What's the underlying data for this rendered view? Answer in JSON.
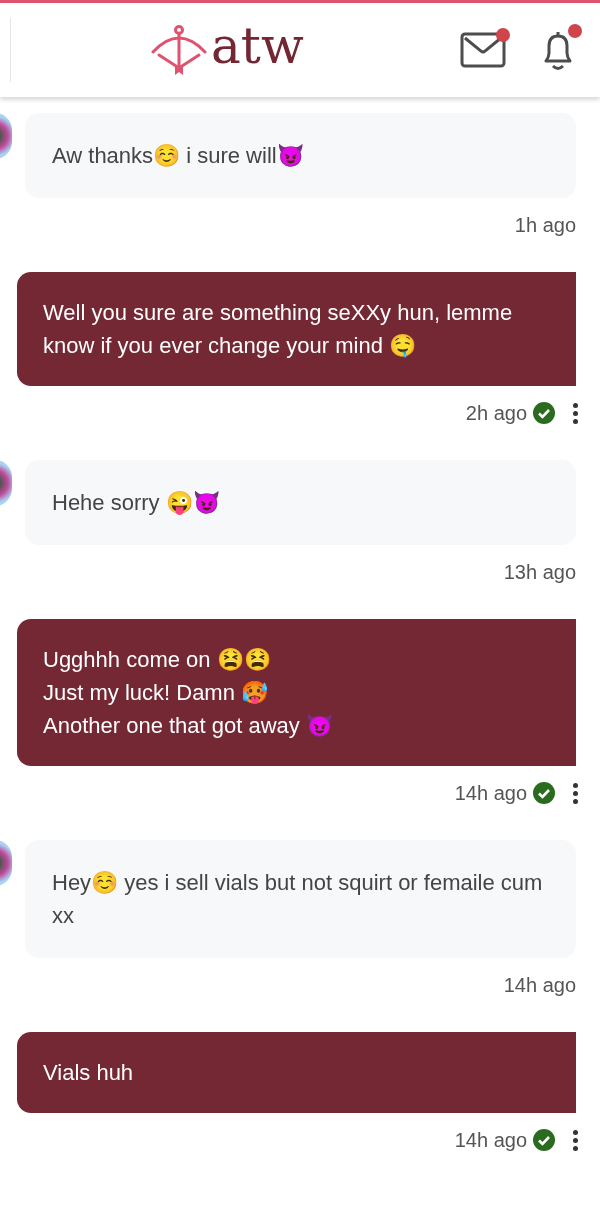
{
  "header": {
    "logo_text": "atw",
    "mail_unread": true,
    "bell_unread": true
  },
  "messages": [
    {
      "kind": "received",
      "text": "Aw thanks☺️ i sure will😈",
      "time": "1h ago"
    },
    {
      "kind": "sent",
      "text": "Well you sure are something seXXy hun, lemme know if you ever change your mind 🤤",
      "time": "2h ago",
      "read": true
    },
    {
      "kind": "received",
      "text": "Hehe sorry 😜😈",
      "time": "13h ago"
    },
    {
      "kind": "sent",
      "text": "Ugghhh come on 😫😫\nJust my luck! Damn 🥵\nAnother one that got away 😈",
      "time": "14h ago",
      "read": true
    },
    {
      "kind": "received",
      "text": "Hey☺️ yes i sell vials but not squirt or femaile cum xx",
      "time": "14h ago"
    },
    {
      "kind": "sent",
      "text": "Vials huh",
      "time": "14h ago",
      "read": true
    }
  ]
}
